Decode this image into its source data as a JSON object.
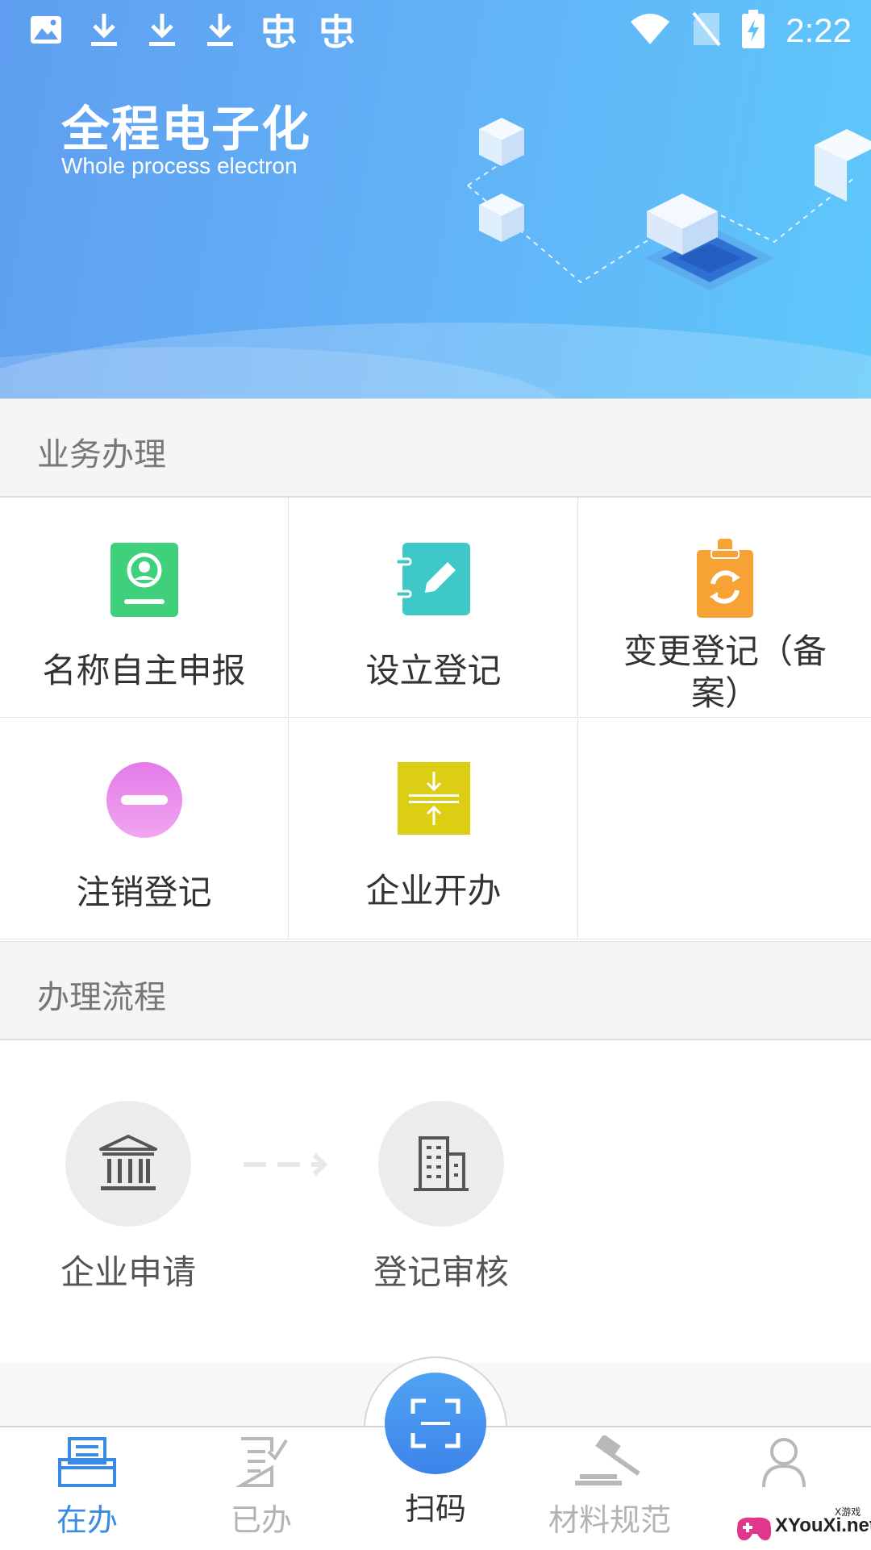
{
  "status_bar": {
    "time": "2:22"
  },
  "banner": {
    "title": "全程电子化",
    "subtitle": "Whole process electron"
  },
  "business": {
    "header": "业务办理",
    "items": [
      {
        "label": "名称自主申报",
        "icon": "id-card-icon",
        "color": "#3ed07a"
      },
      {
        "label": "设立登记",
        "icon": "notepad-pen-icon",
        "color": "#3ec8c8"
      },
      {
        "label": "变更登记（备案）",
        "icon": "clipboard-refresh-icon",
        "color": "#f7a235"
      },
      {
        "label": "注销登记",
        "icon": "minus-circle-icon",
        "color": "#e28ded"
      },
      {
        "label": "企业开办",
        "icon": "compress-icon",
        "color": "#dcce13"
      }
    ]
  },
  "process": {
    "header": "办理流程",
    "steps": [
      {
        "label": "企业申请",
        "icon": "bank-building-icon"
      },
      {
        "label": "登记审核",
        "icon": "office-building-icon"
      }
    ]
  },
  "bottom_nav": {
    "items": [
      {
        "label": "在办",
        "icon": "inbox-tray-icon",
        "active": true
      },
      {
        "label": "已办",
        "icon": "checked-doc-icon",
        "active": false
      },
      {
        "label": "扫码",
        "icon": "scan-icon",
        "active": false
      },
      {
        "label": "材料规范",
        "icon": "gavel-icon",
        "active": false
      },
      {
        "label": "",
        "icon": "user-icon",
        "active": false
      }
    ]
  },
  "watermark": {
    "text": "XYouXi.net",
    "small": "X游戏"
  },
  "colors": {
    "accent": "#3b8be3",
    "banner_start": "#5f9ef0",
    "banner_end": "#5ec8fb"
  }
}
